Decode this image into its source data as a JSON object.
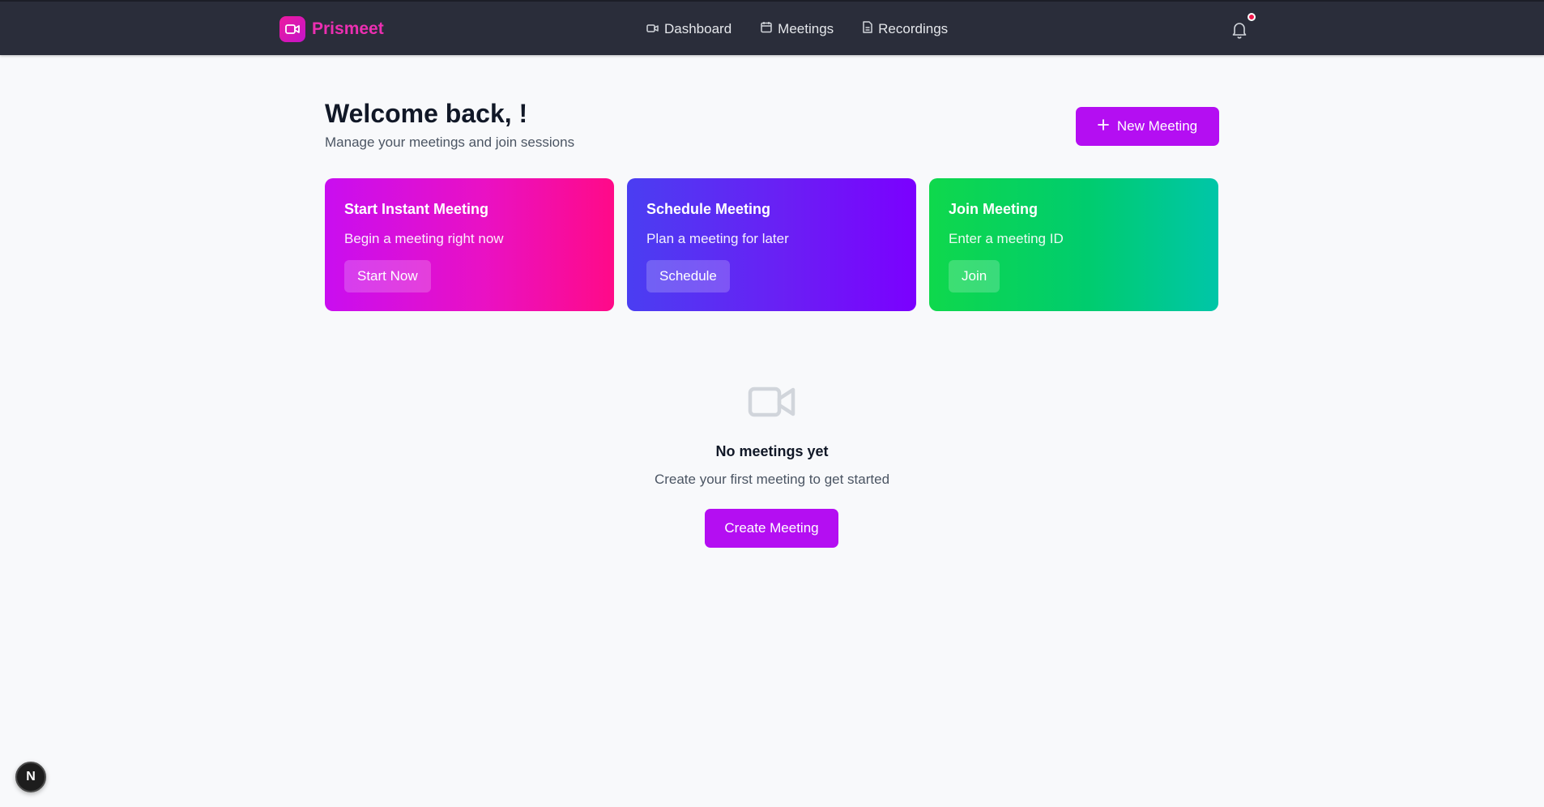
{
  "brand": {
    "name": "Prismeet",
    "logo_icon": "video-camera-icon",
    "color": "#ec2fb1"
  },
  "nav": {
    "items": [
      {
        "label": "Dashboard",
        "icon": "video-camera-icon"
      },
      {
        "label": "Meetings",
        "icon": "calendar-icon"
      },
      {
        "label": "Recordings",
        "icon": "document-icon"
      }
    ],
    "notifications": {
      "icon": "bell-icon",
      "has_unread": true
    }
  },
  "header": {
    "title": "Welcome back, !",
    "subtitle": "Manage your meetings and join sessions",
    "new_meeting_label": "New Meeting"
  },
  "cards": [
    {
      "title": "Start Instant Meeting",
      "description": "Begin a meeting right now",
      "button": "Start Now"
    },
    {
      "title": "Schedule Meeting",
      "description": "Plan a meeting for later",
      "button": "Schedule"
    },
    {
      "title": "Join Meeting",
      "description": "Enter a meeting ID",
      "button": "Join"
    }
  ],
  "empty_state": {
    "icon": "video-camera-icon",
    "title": "No meetings yet",
    "subtitle": "Create your first meeting to get started",
    "button": "Create Meeting"
  },
  "dev_badge": {
    "label": "N"
  },
  "colors": {
    "accent": "#b40ef2",
    "topbar": "#2a2d3a",
    "background": "#f8f9fb"
  }
}
